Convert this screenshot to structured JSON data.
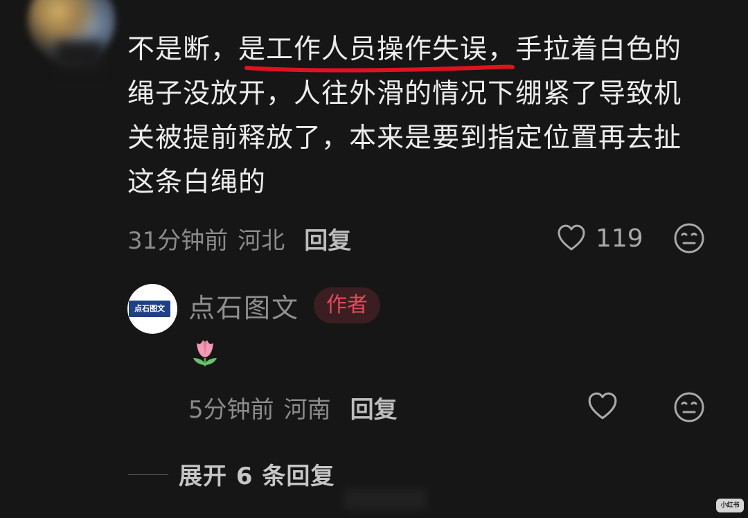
{
  "comment": {
    "lines": [
      "不是断，是工作人员操作失误，手拉着白色的",
      "绳子没放开，人往外滑的情况下绷紧了导致机",
      "关被提前释放了，本来是要到指定位置再去扯",
      "这条白绳的"
    ],
    "line1_part1": "不是断，",
    "line1_highlight": "是工作人员操作失误",
    "line1_part2": "，手拉着白色的",
    "time": "31分钟前",
    "location": "河北",
    "reply_label": "回复",
    "like_count": "119",
    "annotation_color": "#e0121f"
  },
  "author_reply": {
    "name": "点石图文",
    "badge": "作者",
    "avatar_text": "点石图文",
    "emoji": "🌷",
    "time": "5分钟前",
    "location": "河南",
    "reply_label": "回复"
  },
  "expand": {
    "label": "展开 6 条回复"
  },
  "watermark": {
    "corner_text": "小红书"
  },
  "icons": {
    "like": "heart-outline-icon",
    "dislike": "meh-face-icon",
    "emoji": "tulip-icon"
  }
}
